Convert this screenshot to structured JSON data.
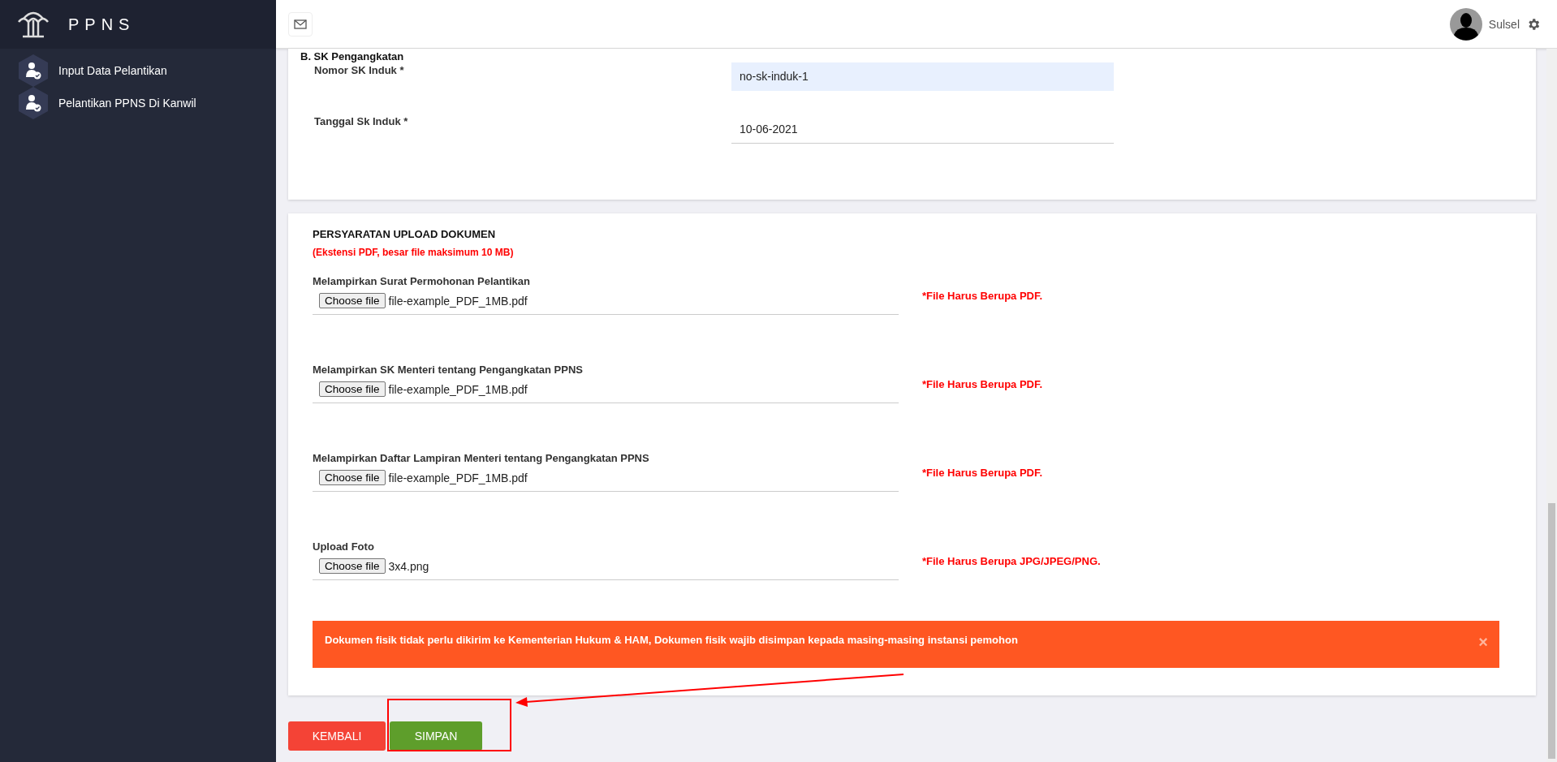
{
  "brand": {
    "name": "PPNS"
  },
  "sidebar": {
    "items": [
      {
        "label": "Input Data Pelantikan"
      },
      {
        "label": "Pelantikan PPNS Di Kanwil"
      }
    ]
  },
  "header": {
    "user": "Sulsel"
  },
  "sk_section": {
    "title": "B. SK Pengangkatan",
    "fields": [
      {
        "label": "Nomor SK Induk *",
        "value": "no-sk-induk-1",
        "autofilled": true
      },
      {
        "label": "Tanggal Sk Induk *",
        "value": "10-06-2021",
        "autofilled": false
      }
    ]
  },
  "upload_section": {
    "title": "PERSYARATAN UPLOAD DOKUMEN",
    "subtitle": "(Ekstensi PDF, besar file maksimum 10 MB)",
    "items": [
      {
        "label": "Melampirkan Surat Permohonan Pelantikan",
        "button": "Choose file",
        "file": "file-example_PDF_1MB.pdf",
        "note": "*File Harus Berupa PDF."
      },
      {
        "label": "Melampirkan SK Menteri tentang Pengangkatan PPNS",
        "button": "Choose file",
        "file": "file-example_PDF_1MB.pdf",
        "note": "*File Harus Berupa PDF."
      },
      {
        "label": "Melampirkan Daftar Lampiran Menteri tentang Pengangkatan PPNS",
        "button": "Choose file",
        "file": "file-example_PDF_1MB.pdf",
        "note": "*File Harus Berupa PDF."
      },
      {
        "label": "Upload Foto",
        "button": "Choose file",
        "file": "3x4.png",
        "note": "*File Harus Berupa JPG/JPEG/PNG."
      }
    ],
    "alert": {
      "text": "Dokumen fisik tidak perlu dikirim ke Kementerian Hukum & HAM, Dokumen fisik wajib disimpan kepada masing-masing instansi pemohon",
      "close": "×"
    }
  },
  "buttons": [
    {
      "label": "KEMBALI",
      "kind": "back"
    },
    {
      "label": "SIMPAN",
      "kind": "save"
    }
  ]
}
